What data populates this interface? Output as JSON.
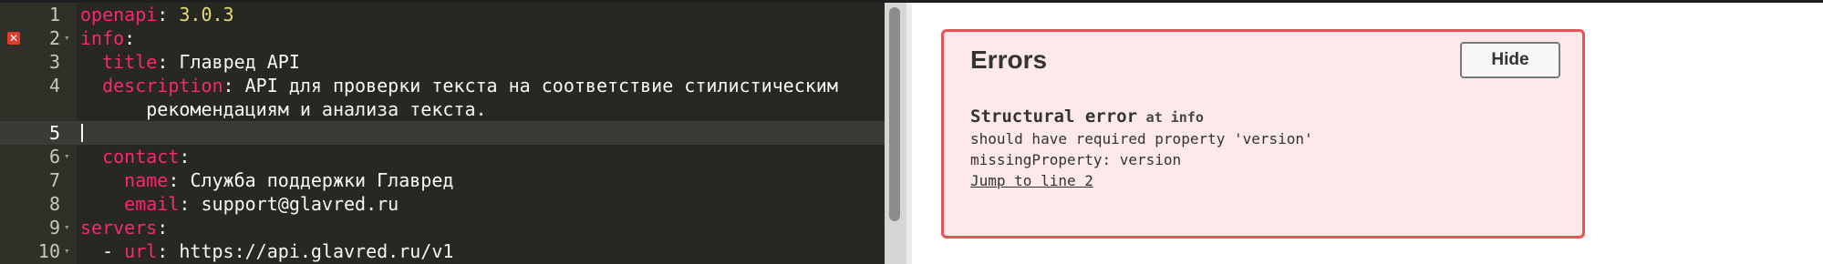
{
  "editor": {
    "lines": [
      {
        "num": "1",
        "key": "openapi",
        "value": "3.0.3",
        "value_kind": "number",
        "indent": ""
      },
      {
        "num": "2",
        "key": "info",
        "value": "",
        "indent": "",
        "fold": true,
        "error": true
      },
      {
        "num": "3",
        "key": "title",
        "value": "Главред API",
        "indent": "  "
      },
      {
        "num": "4",
        "key": "description",
        "value": "API для проверки текста на соответствие стилистическим",
        "indent": "  "
      },
      {
        "num": "",
        "key": "",
        "value": "рекомендациям и анализа текста.",
        "indent": "    "
      },
      {
        "num": "5",
        "key": "",
        "value": "",
        "indent": "",
        "active": true
      },
      {
        "num": "6",
        "key": "contact",
        "value": "",
        "indent": "  ",
        "fold": true
      },
      {
        "num": "7",
        "key": "name",
        "value": "Служба поддержки Главред",
        "indent": "    "
      },
      {
        "num": "8",
        "key": "email",
        "value": "support@glavred.ru",
        "indent": "    "
      },
      {
        "num": "9",
        "key": "servers",
        "value": "",
        "indent": "",
        "fold": true
      },
      {
        "num": "10",
        "key": "url",
        "value": "https://api.glavred.ru/v1",
        "indent": "  - ",
        "fold": true
      }
    ]
  },
  "errors_panel": {
    "title": "Errors",
    "hide_label": "Hide",
    "error": {
      "heading": "Structural error",
      "at_label": "at info",
      "message": "should have required property 'version'",
      "detail": "missingProperty: version",
      "jump_link": "Jump to line 2"
    }
  },
  "colors": {
    "editor_bg": "#272822",
    "key": "#f92672",
    "number": "#e6db74",
    "error_bg": "#fde9ea",
    "error_border": "#e8535a"
  }
}
